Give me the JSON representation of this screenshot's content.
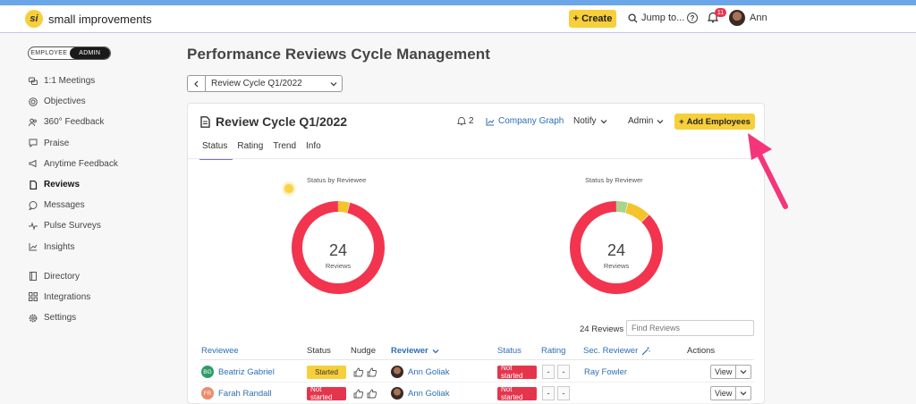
{
  "app": {
    "logo_text": "small improvements",
    "create_label": "Create",
    "jump_label": "Jump to...",
    "notifications_count": "11",
    "user_name": "Ann"
  },
  "sidebar": {
    "toggle": {
      "employee": "EMPLOYEE",
      "admin": "ADMIN"
    },
    "items": [
      {
        "label": "1:1 Meetings",
        "icon": "chat-bubbles-icon"
      },
      {
        "label": "Objectives",
        "icon": "target-icon"
      },
      {
        "label": "360° Feedback",
        "icon": "people-icon"
      },
      {
        "label": "Praise",
        "icon": "speech-bubble-icon"
      },
      {
        "label": "Anytime Feedback",
        "icon": "megaphone-icon"
      },
      {
        "label": "Reviews",
        "icon": "document-icon",
        "active": true
      },
      {
        "label": "Messages",
        "icon": "message-icon"
      },
      {
        "label": "Pulse Surveys",
        "icon": "pulse-icon"
      },
      {
        "label": "Insights",
        "icon": "chart-icon"
      },
      {
        "label": "Directory",
        "icon": "book-icon"
      },
      {
        "label": "Integrations",
        "icon": "grid-icon"
      },
      {
        "label": "Settings",
        "icon": "gear-icon"
      }
    ]
  },
  "page": {
    "title": "Performance Reviews Cycle Management",
    "cycle_selector": "Review Cycle Q1/2022"
  },
  "card": {
    "title": "Review Cycle Q1/2022",
    "reminder_count": "2",
    "company_graph": "Company Graph",
    "notify": "Notify",
    "admin": "Admin",
    "add_employees": "Add Employees",
    "tabs": [
      "Status",
      "Rating",
      "Trend",
      "Info"
    ],
    "active_tab": "Status"
  },
  "charts": {
    "reviewee": {
      "label": "Status by Reviewee",
      "count": "24",
      "unit": "Reviews"
    },
    "reviewer": {
      "label": "Status by Reviewer",
      "count": "24",
      "unit": "Reviews"
    }
  },
  "chart_data": [
    {
      "type": "pie",
      "title": "Status by Reviewee",
      "center_value": 24,
      "center_label": "Reviews",
      "slices": [
        {
          "value": 23,
          "color": "#f2344f"
        },
        {
          "value": 1,
          "color": "#f5c32c"
        }
      ]
    },
    {
      "type": "pie",
      "title": "Status by Reviewer",
      "center_value": 24,
      "center_label": "Reviews",
      "slices": [
        {
          "value": 21,
          "color": "#f2344f"
        },
        {
          "value": 1,
          "color": "#a8d58a"
        },
        {
          "value": 2,
          "color": "#f5c32c"
        }
      ]
    }
  ],
  "table": {
    "count_label": "24 Reviews",
    "search_placeholder": "Find Reviews",
    "headers": {
      "reviewee": "Reviewee",
      "status": "Status",
      "nudge": "Nudge",
      "reviewer": "Reviewer",
      "status2": "Status",
      "rating": "Rating",
      "sec_reviewer": "Sec. Reviewer",
      "actions": "Actions"
    },
    "rows": [
      {
        "initials": "BG",
        "initials_color": "#2e9c6a",
        "reviewee": "Beatriz Gabriel",
        "status": "Started",
        "reviewer": "Ann Goliak",
        "reviewer_status": "Not started",
        "rating1": "-",
        "rating2": "-",
        "sec_reviewer": "Ray Fowler",
        "view": "View"
      },
      {
        "initials": "FR",
        "initials_color": "#f08a6b",
        "reviewee": "Farah Randall",
        "status": "Not started",
        "reviewer": "Ann Goliak",
        "reviewer_status": "Not started",
        "rating1": "-",
        "rating2": "-",
        "sec_reviewer": "",
        "view": "View"
      }
    ]
  }
}
